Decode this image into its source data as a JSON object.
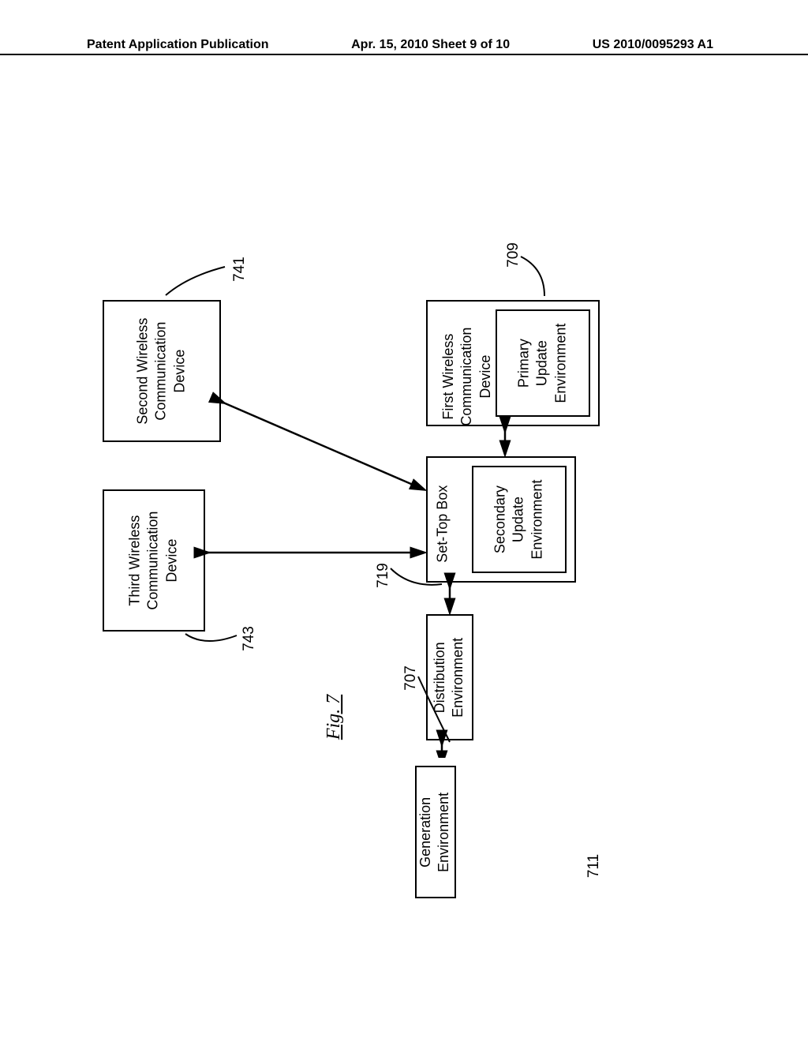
{
  "header": {
    "left": "Patent Application Publication",
    "center": "Apr. 15, 2010  Sheet 9 of 10",
    "right": "US 2010/0095293 A1"
  },
  "blocks": {
    "first_device": "First Wireless\nCommunication\nDevice",
    "primary_env": "Primary\nUpdate\nEnvironment",
    "settop": "Set-Top Box",
    "secondary_env": "Secondary\nUpdate\nEnvironment",
    "distribution": "Distribution\nEnvironment",
    "generation": "Generation\nEnvironment",
    "second_device": "Second Wireless\nCommunication\nDevice",
    "third_device": "Third Wireless\nCommunication\nDevice"
  },
  "refs": {
    "r709": "709",
    "r719": "719",
    "r707": "707",
    "r711": "711",
    "r741": "741",
    "r743": "743"
  },
  "figure_label": "Fig. 7"
}
